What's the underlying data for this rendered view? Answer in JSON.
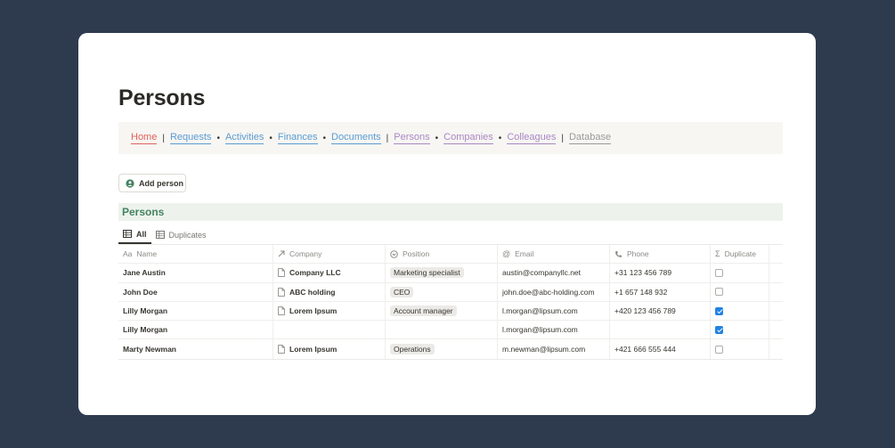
{
  "page": {
    "title": "Persons"
  },
  "nav": {
    "items": [
      {
        "label": "Home",
        "color": "#e16259",
        "sep": "|"
      },
      {
        "label": "Requests",
        "color": "#5b9bd1",
        "sep": "•"
      },
      {
        "label": "Activities",
        "color": "#5b9bd1",
        "sep": "•"
      },
      {
        "label": "Finances",
        "color": "#5b9bd1",
        "sep": "•"
      },
      {
        "label": "Documents",
        "color": "#5b9bd1",
        "sep": "|"
      },
      {
        "label": "Persons",
        "color": "#a987c4",
        "sep": "•"
      },
      {
        "label": "Companies",
        "color": "#a987c4",
        "sep": "•"
      },
      {
        "label": "Colleagues",
        "color": "#a987c4",
        "sep": "|"
      },
      {
        "label": "Database",
        "color": "#9b9a97",
        "sep": ""
      }
    ]
  },
  "actions": {
    "add_person": "Add person"
  },
  "database": {
    "title": "Persons",
    "views": [
      "All",
      "Duplicates"
    ],
    "columns": {
      "name": "Name",
      "name_prefix": "Aa",
      "company": "Company",
      "position": "Position",
      "email": "Email",
      "phone": "Phone",
      "duplicate": "Duplicate"
    },
    "rows": [
      {
        "name": "Jane Austin",
        "company": "Company LLC",
        "position": "Marketing specialist",
        "email": "austin@companyllc.net",
        "phone": "+31 123 456 789",
        "duplicate": false
      },
      {
        "name": "John Doe",
        "company": "ABC holding",
        "position": "CEO",
        "email": "john.doe@abc-holding.com",
        "phone": "+1 657 148 932",
        "duplicate": false
      },
      {
        "name": "Lilly Morgan",
        "company": "Lorem Ipsum",
        "position": "Account manager",
        "email": "l.morgan@lipsum.com",
        "phone": "+420 123 456 789",
        "duplicate": true
      },
      {
        "name": "Lilly Morgan",
        "company": "",
        "position": "",
        "email": "l.morgan@lipsum.com",
        "phone": "",
        "duplicate": true
      },
      {
        "name": "Marty Newman",
        "company": "Lorem Ipsum",
        "position": "Operations",
        "email": "m.newman@lipsum.com",
        "phone": "+421 666 555 444",
        "duplicate": false
      }
    ]
  },
  "colors": {
    "background": "#2e3a4e",
    "accent": "#2383e2",
    "db_title": "#448361"
  }
}
